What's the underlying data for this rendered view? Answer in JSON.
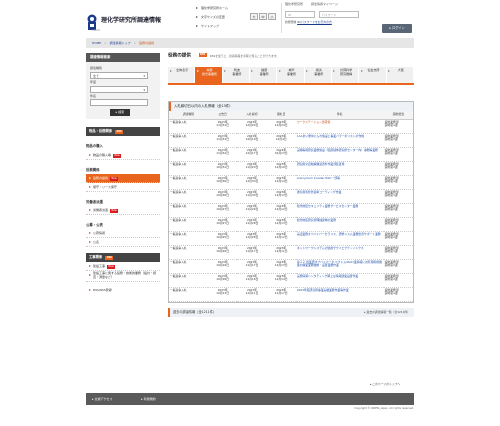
{
  "header": {
    "site_title": "理化学研究所調達情報",
    "site_sub": "RIKEN",
    "links": [
      "理化学研究所ホーム",
      "文字サイズの変更",
      "サイトマップ"
    ],
    "font_sizes": [
      "大",
      "中",
      "小"
    ],
    "login_tabs": [
      "理化学研究所",
      "調達情報マイページ"
    ],
    "login_id_placeholder": "ID",
    "login_pw_placeholder": "パスワード",
    "login_note": "新規登録",
    "login_note_link": "ID/パスワードをお忘れの方",
    "login_button": "ログイン"
  },
  "breadcrumb": [
    "HOME",
    "調達情報トップ",
    "役務の提供"
  ],
  "sidebar": {
    "search_title": "調達情報検索",
    "label_kind": "調達種別",
    "kind_value": "全て",
    "label_year": "年度",
    "year_value": "",
    "label_keyword": "件名",
    "search_button": "検索",
    "goods_title": "物品・役務関係",
    "goods_heading": "物品の購入",
    "goods_items": [
      "物品の購入等"
    ],
    "service_heading": "役務関係",
    "service_items": [
      "役務の提供",
      "保守・リース保守"
    ],
    "labor_heading": "労働者派遣",
    "labor_items": [
      "労働者派遣"
    ],
    "public_heading": "公募・公表",
    "public_items": [
      "公募情報",
      "公表"
    ],
    "construction_title": "工事関係",
    "construction_items": [
      "建設工事",
      "建設工事に関する役務・技術的業務（設計・調査・測量など）"
    ],
    "extra_items": [
      "RSS/RSS登録"
    ],
    "new_label": "New"
  },
  "main": {
    "title": "役務の提供",
    "rss_label": "RSS",
    "rss_note": "RSSを使うと、新着情報を手軽に知ることができます。",
    "tabs": [
      {
        "label": "全体表示",
        "active": false
      },
      {
        "label": "本部\n和光事業所",
        "active": true
      },
      {
        "label": "筑波\n事業所",
        "active": false
      },
      {
        "label": "播磨\n事業所",
        "active": false
      },
      {
        "label": "神戸\n事業所",
        "active": false
      },
      {
        "label": "横浜\n事業所",
        "active": false
      },
      {
        "label": "計算科学\n研究機構",
        "active": false
      },
      {
        "label": "仙台支所",
        "active": false
      },
      {
        "label": "大阪",
        "active": false
      }
    ],
    "list_heading": "入札締切日以内の入札情報（全13件）",
    "columns": [
      "調達種別",
      "公告日",
      "入札締切",
      "開札日",
      "件名",
      "契約担当"
    ],
    "rows": [
      [
        "一般競争入札",
        "2023年\n11月31日",
        "2023年\n12月20日",
        "2023年\n12月24日",
        "ワークステーション賃貸借",
        "契約業務部\n契約第1課"
      ],
      [
        "一般競争入札",
        "2023年\n11月31日",
        "2023年\n12月19日",
        "2023年\n12月4日",
        "1AAまい便中にんれ施設と事業バラ一ボリストの作成",
        "契約業務部\n契約第2課"
      ],
      [
        "一般競争入札",
        "2023年\n11月31日",
        "2023年\n12月17日",
        "2024年\n01月13日",
        "実験等用研究業務施設（臨床検体研究所センター内）事務等業務",
        "契約業務部\n契約第1課"
      ],
      [
        "一般競争入札",
        "2023年\n10月31日",
        "2023年\n11月20日",
        "2023年\n12月19日",
        "研究用全自動解離装置外作業部装置用",
        "契約業務部\n契約第2課"
      ],
      [
        "一般競争入札",
        "2023年\n10月30日",
        "2023年\n11月30日",
        "2023年\n12月14日",
        "Anonymum Invader 840 一部等",
        "契約業務部\n契約第1課"
      ],
      [
        "一般競争入札",
        "2023年\n10月30日",
        "2023年\n11月30日",
        "2023年\n12月13日",
        "通気用乳管外装単コーティング作業",
        "契約業務部\n契約第1課"
      ],
      [
        "一般競争入札",
        "2023年\n10月27日",
        "2023年\n11月29日",
        "2023年\n12月12日",
        "和光地区セキュリティ業務サービスセンター業務",
        "契約業務部\n契約第2課"
      ],
      [
        "一般競争入札",
        "2023年\n10月27日",
        "2023年\n11月28日",
        "2023年\n12月13日",
        "和光地区研究管理棟建物の業務",
        "契約業務部\n契約第2課"
      ],
      [
        "一般競争入札",
        "2023年\n10月25日",
        "2023年\n11月28日",
        "2023年\n12月12日",
        "実証業務オペバイバーセラリス、研修シスム業務監査サポート業務",
        "契約業務部\n契約第2課"
      ],
      [
        "一般競争入札",
        "2023年\n10月20日",
        "2023年\n11月17日",
        "2023年\n12月11日",
        "ネットワークシステムの監視サクイエクテンノニクス",
        "契約業務部\n契約第1課"
      ],
      [
        "一般競争入札",
        "2023年\n10月19日",
        "2023年\n11月17日",
        "2023年\n12月13日",
        "第１２ 世業研オプバイパータ ベクシム(RAC)業情報に共有用利用推進の構築業務技術・設置業務作業",
        "契約業務部\n契約第2課"
      ],
      [
        "一般競争入札",
        "2023年\n10月18日",
        "2023年\n11月16日",
        "2023年\n12月14日",
        "実態情報ハンタティング網上は情報建築設置作業",
        "契約業務部\n契約第2課"
      ],
      [
        "一般競争入札",
        "2023年\n10月13日",
        "2023年\n11月11日",
        "2023年\n11月17日",
        "2023年度研究所事業実績業務作業等作業",
        "契約業務部\n契約第1課"
      ]
    ],
    "past_heading": "過去の調達情報（全1211件）",
    "past_more": "過去の調達情報一覧（全1211件）",
    "page_top": "このページのトップへ"
  },
  "footer": {
    "links": [
      "交通アクセス",
      "利用規約"
    ],
    "copyright": "Copyright © RIKEN, Japan. All rights reserved."
  }
}
